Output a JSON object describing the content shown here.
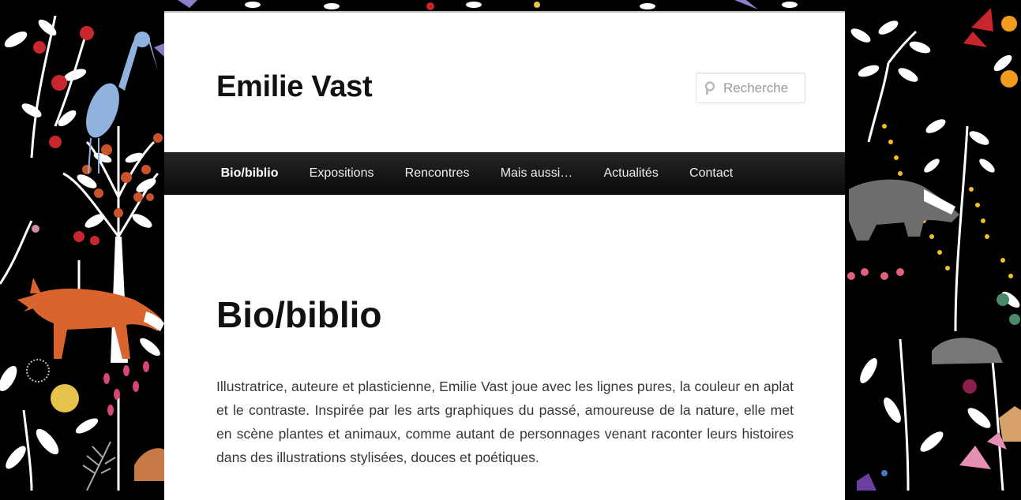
{
  "site": {
    "title": "Emilie Vast"
  },
  "search": {
    "placeholder": "Recherche"
  },
  "nav": {
    "items": [
      {
        "label": "Bio/biblio",
        "current": true
      },
      {
        "label": "Expositions",
        "current": false
      },
      {
        "label": "Rencontres",
        "current": false
      },
      {
        "label": "Mais aussi…",
        "current": false
      },
      {
        "label": "Actualités",
        "current": false
      },
      {
        "label": "Contact",
        "current": false
      }
    ]
  },
  "entry": {
    "title": "Bio/biblio",
    "paragraph": "Illustratrice, auteure et plasticienne, Emilie Vast joue avec les lignes pures, la couleur en aplat et le contraste. Inspirée par les arts graphiques du passé, amoureuse de la nature, elle met en scène plantes et animaux, comme autant de personnages venant raconter leurs histoires dans des illustrations stylisées, douces et poétiques."
  },
  "colors": {
    "background": "#000000",
    "page": "#ffffff",
    "nav": "#1a1a1a",
    "fox": "#d9642e",
    "heron": "#8fb3de",
    "badger": "#6d6d6d"
  }
}
